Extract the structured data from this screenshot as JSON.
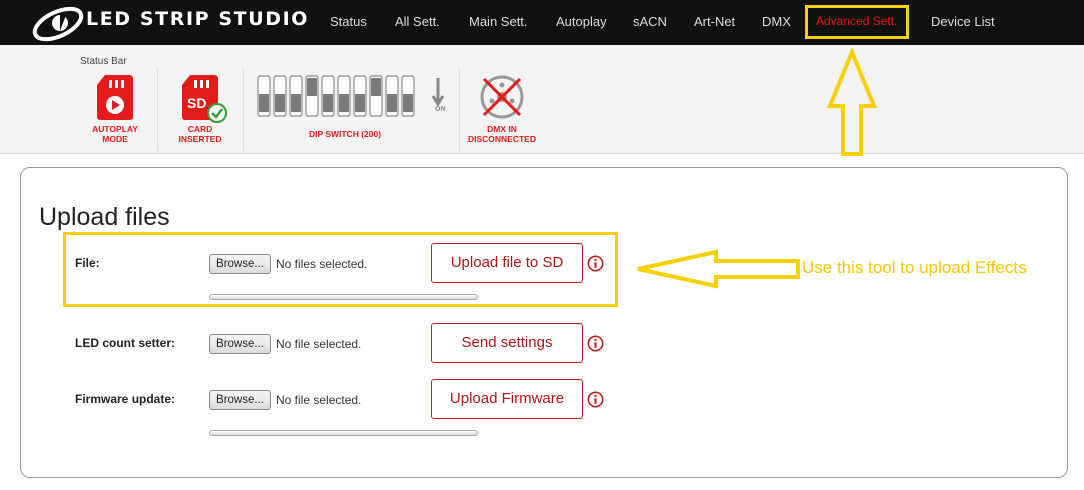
{
  "nav": {
    "logo_text": "LED STRIP STUDIO",
    "items": [
      {
        "label": "Status"
      },
      {
        "label": "All Sett."
      },
      {
        "label": "Main Sett."
      },
      {
        "label": "Autoplay"
      },
      {
        "label": "sACN"
      },
      {
        "label": "Art-Net"
      },
      {
        "label": "DMX"
      },
      {
        "label": "Advanced Sett.",
        "active": true
      },
      {
        "label": "Device List"
      }
    ]
  },
  "status_bar": {
    "caption": "Status Bar",
    "autoplay": {
      "line1": "AUTOPLAY",
      "line2": "MODE",
      "icon": "sd-card-play-icon"
    },
    "card": {
      "line1": "CARD",
      "line2": "INSERTED",
      "icon_text": "SD",
      "icon": "sd-card-check-icon"
    },
    "dip": {
      "label": "DIP SWITCH (200)",
      "on_text": "ON",
      "icon": "dip-switch-icon"
    },
    "dmx": {
      "line1": "DMX IN",
      "line2": "DISCONNECTED",
      "icon": "dmx-disconnected-icon"
    }
  },
  "upload": {
    "title": "Upload files",
    "rows": [
      {
        "label": "File:",
        "browse": "Browse...",
        "status": "No files selected.",
        "button": "Upload file to SD"
      },
      {
        "label": "LED count setter:",
        "browse": "Browse...",
        "status": "No file selected.",
        "button": "Send settings"
      },
      {
        "label": "Firmware update:",
        "browse": "Browse...",
        "status": "No file selected.",
        "button": "Upload Firmware"
      }
    ]
  },
  "annotation": {
    "text": "Use this tool to upload Effects"
  },
  "colors": {
    "accent": "#e41b1b",
    "highlight": "#f7d000",
    "nav_bg": "#111111"
  }
}
